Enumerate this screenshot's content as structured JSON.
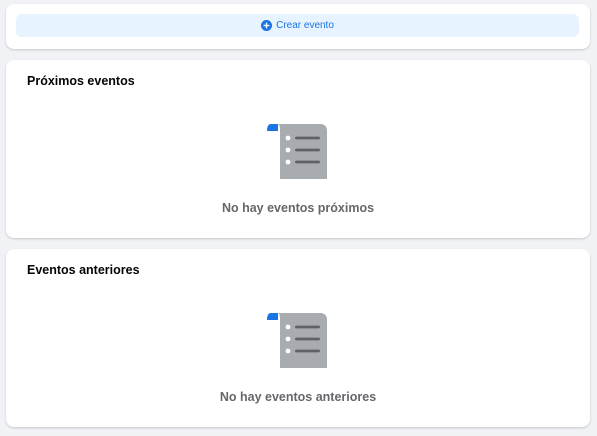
{
  "create_event": {
    "label": "Crear evento",
    "icon": "plus-circle-icon",
    "accent_color": "#1b74e4",
    "background_color": "#e7f3ff"
  },
  "upcoming": {
    "title": "Próximos eventos",
    "empty_icon": "document-list-icon",
    "empty_message": "No hay eventos próximos"
  },
  "past": {
    "title": "Eventos anteriores",
    "empty_icon": "document-list-icon",
    "empty_message": "No hay eventos anteriores"
  },
  "colors": {
    "page_background": "#f0f2f5",
    "card_background": "#ffffff",
    "icon_gray": "#a8abaf",
    "icon_accent": "#1b74e4",
    "muted_text": "#65676b"
  }
}
